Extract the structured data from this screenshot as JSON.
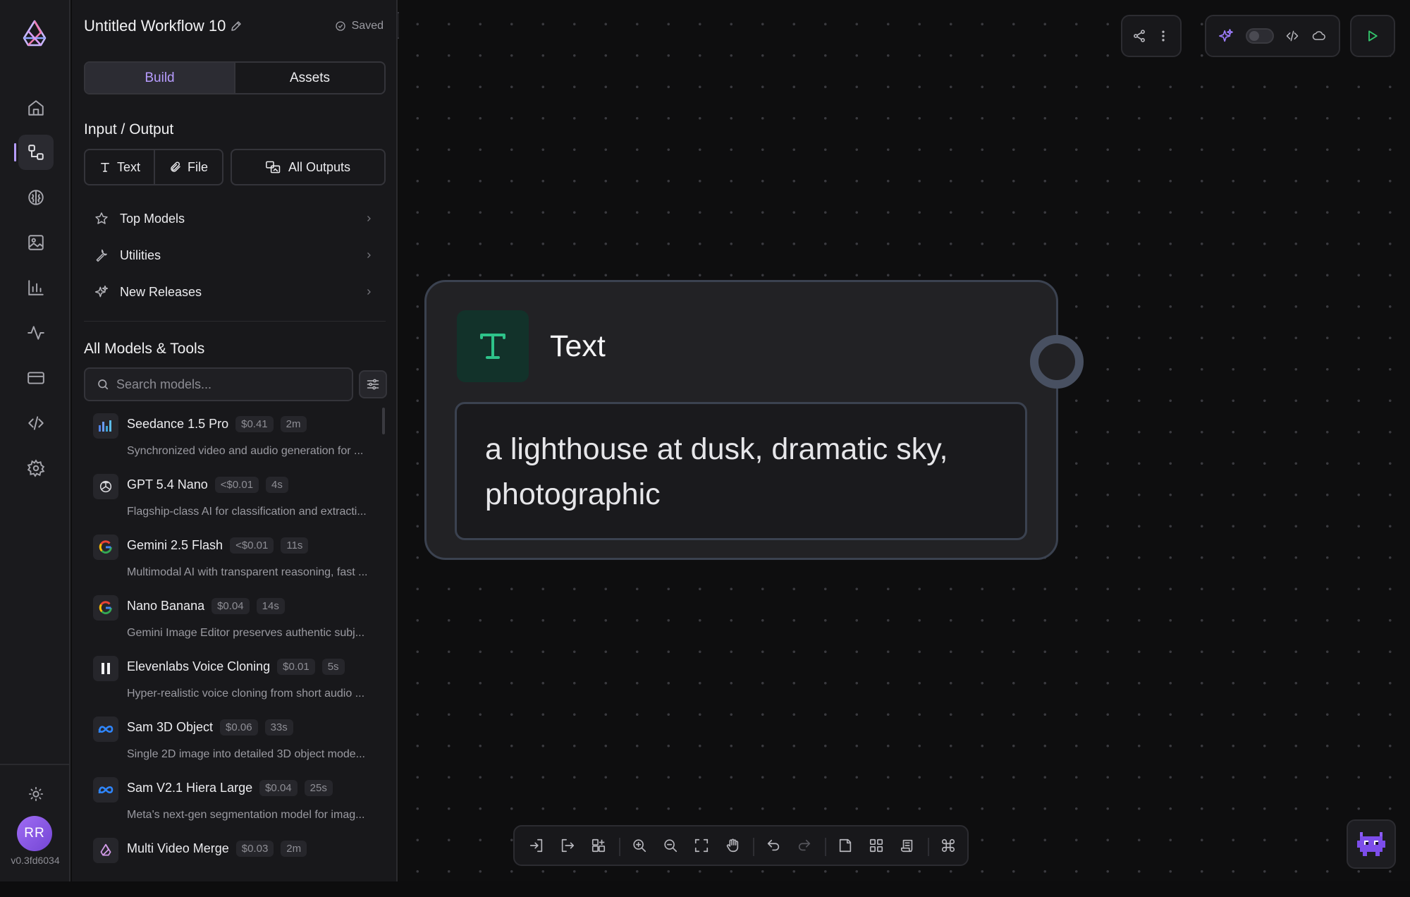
{
  "rail": {
    "logo_icon": "brand-logo-icon",
    "nav": [
      {
        "name": "home-icon"
      },
      {
        "name": "workflow-icon",
        "active": true
      },
      {
        "name": "brain-icon"
      },
      {
        "name": "image-icon"
      },
      {
        "name": "bar-chart-icon"
      },
      {
        "name": "activity-icon"
      },
      {
        "name": "credit-card-icon"
      },
      {
        "name": "code-icon"
      },
      {
        "name": "settings-icon"
      }
    ],
    "theme_icon": "sun-icon",
    "avatar_initials": "RR",
    "version": "v0.3fd6034"
  },
  "panel": {
    "title": "Untitled Workflow 10",
    "saved_label": "Saved",
    "tabs": [
      {
        "label": "Build",
        "active": true
      },
      {
        "label": "Assets",
        "active": false
      }
    ],
    "io_heading": "Input / Output",
    "io_buttons": {
      "text": "Text",
      "file": "File",
      "all_outputs": "All Outputs"
    },
    "categories": [
      {
        "label": "Top Models",
        "icon": "star-icon"
      },
      {
        "label": "Utilities",
        "icon": "wrench-icon"
      },
      {
        "label": "New Releases",
        "icon": "sparkle-icon"
      }
    ],
    "models_heading": "All Models & Tools",
    "search": {
      "placeholder": "Search models...",
      "value": ""
    },
    "models": [
      {
        "name": "Seedance 1.5 Pro",
        "price": "$0.41",
        "time": "2m",
        "desc": "Synchronized video and audio generation for ...",
        "icon": "seedance-icon"
      },
      {
        "name": "GPT 5.4 Nano",
        "price": "<$0.01",
        "time": "4s",
        "desc": "Flagship-class AI for classification and extracti...",
        "icon": "openai-icon"
      },
      {
        "name": "Gemini 2.5 Flash",
        "price": "<$0.01",
        "time": "11s",
        "desc": "Multimodal AI with transparent reasoning, fast ...",
        "icon": "google-icon"
      },
      {
        "name": "Nano Banana",
        "price": "$0.04",
        "time": "14s",
        "desc": "Gemini Image Editor preserves authentic subj...",
        "icon": "google-icon"
      },
      {
        "name": "Elevenlabs Voice Cloning",
        "price": "$0.01",
        "time": "5s",
        "desc": "Hyper-realistic voice cloning from short audio ...",
        "icon": "elevenlabs-icon"
      },
      {
        "name": "Sam 3D Object",
        "price": "$0.06",
        "time": "33s",
        "desc": "Single 2D image into detailed 3D object mode...",
        "icon": "meta-icon"
      },
      {
        "name": "Sam V2.1 Hiera Large",
        "price": "$0.04",
        "time": "25s",
        "desc": "Meta's next-gen segmentation model for imag...",
        "icon": "meta-icon"
      },
      {
        "name": "Multi Video Merge",
        "price": "$0.03",
        "time": "2m",
        "desc": "",
        "icon": "brand-logo-icon"
      }
    ]
  },
  "canvas": {
    "node": {
      "title": "Text",
      "icon": "text-t-icon",
      "content": "a lighthouse at dusk, dramatic sky, photographic"
    },
    "top_toolbar": [
      "share-icon",
      "more-vertical-icon",
      "sparkle-icon",
      "toggle",
      "code-icon",
      "cloud-icon",
      "play-icon"
    ],
    "bottom_toolbar": [
      "import-icon",
      "export-icon",
      "add-block-icon",
      "zoom-in-icon",
      "zoom-out-icon",
      "fit-view-icon",
      "hand-icon",
      "undo-icon",
      "redo-icon",
      "note-icon",
      "grid-icon",
      "script-icon",
      "command-icon"
    ]
  },
  "colors": {
    "accent": "#b79cff",
    "node_green": "#2ec48a",
    "run_green": "#33c46b"
  }
}
